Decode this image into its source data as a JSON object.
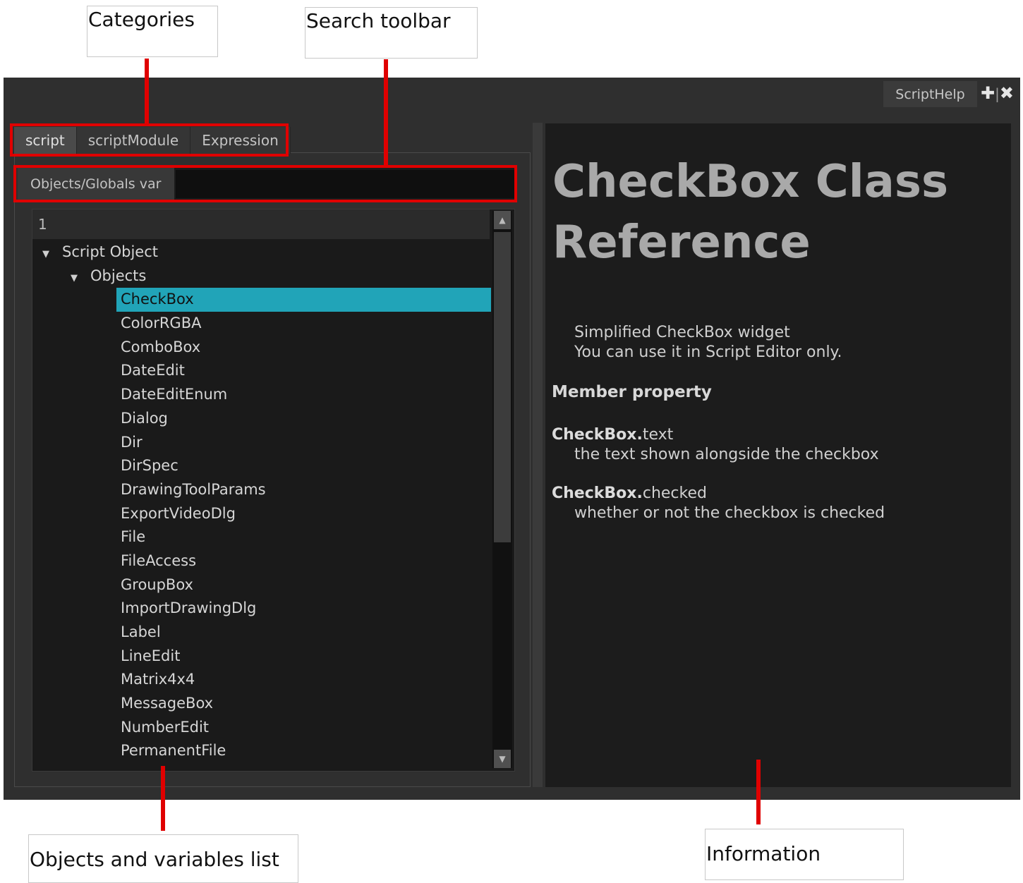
{
  "annotations": {
    "categories": "Categories",
    "search_toolbar": "Search toolbar",
    "objects_list": "Objects and variables list",
    "information": "Information"
  },
  "window": {
    "tab_title": "ScriptHelp",
    "icons": [
      "plus-icon",
      "close-icon"
    ]
  },
  "categories": {
    "tabs": [
      {
        "label": "script",
        "active": true
      },
      {
        "label": "scriptModule",
        "active": false
      },
      {
        "label": "Expression",
        "active": false
      }
    ]
  },
  "search": {
    "label": "Objects/Globals var",
    "value": ""
  },
  "tree": {
    "header": "1",
    "root": "Script Object",
    "group": "Objects",
    "selected": "CheckBox",
    "items": [
      "CheckBox",
      "ColorRGBA",
      "ComboBox",
      "DateEdit",
      "DateEditEnum",
      "Dialog",
      "Dir",
      "DirSpec",
      "DrawingToolParams",
      "ExportVideoDlg",
      "File",
      "FileAccess",
      "GroupBox",
      "ImportDrawingDlg",
      "Label",
      "LineEdit",
      "Matrix4x4",
      "MessageBox",
      "NumberEdit",
      "PermanentFile"
    ]
  },
  "info": {
    "title": "CheckBox Class Reference",
    "description_line1": "Simplified CheckBox widget",
    "description_line2": "You can use it in Script Editor only.",
    "section": "Member property",
    "properties": [
      {
        "class": "CheckBox.",
        "attr": "text",
        "desc": "the text shown alongside the checkbox"
      },
      {
        "class": "CheckBox.",
        "attr": "checked",
        "desc": "whether or not the checkbox is checked"
      }
    ]
  },
  "colors": {
    "highlight": "#e00000",
    "selection": "#21a4b8",
    "background": "#2f2f2f"
  }
}
